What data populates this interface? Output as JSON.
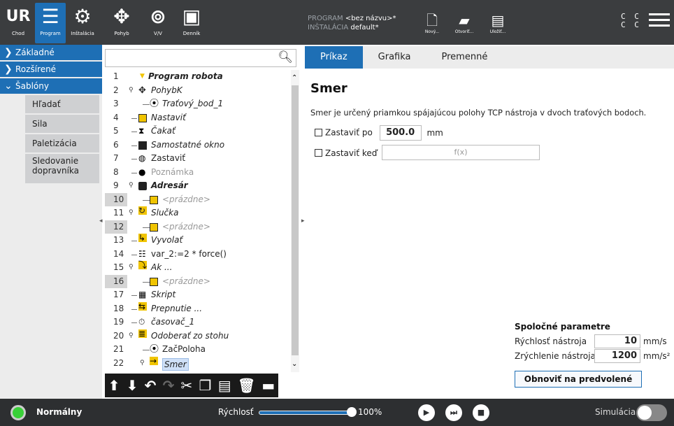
{
  "nav": {
    "chod": "Chod",
    "program": "Program",
    "instalacia": "Inštalácia",
    "pohyb": "Pohyb",
    "vv": "V/V",
    "dennik": "Denník"
  },
  "program_info": {
    "program_key": "PROGRAM",
    "program_val": "<bez názvu>*",
    "install_key": "INŠTALÁCIA",
    "install_val": "default*"
  },
  "file": {
    "new": "Nový...",
    "open": "Otvoriť...",
    "save": "Uložiť..."
  },
  "cc": {
    "line1": "C C",
    "line2": "C C"
  },
  "leftmenu": {
    "zakladne": "Základné",
    "rozsirene": "Rozšírené",
    "sablony": "Šablóny",
    "subs": [
      "Hľadať",
      "Sila",
      "Paletizácia",
      "Sledovanie dopravníka"
    ]
  },
  "tree": [
    {
      "n": "1",
      "t": "Program robota"
    },
    {
      "n": "2",
      "t": "PohybK"
    },
    {
      "n": "3",
      "t": "Traťový_bod_1"
    },
    {
      "n": "4",
      "t": "Nastaviť"
    },
    {
      "n": "5",
      "t": "Čakať"
    },
    {
      "n": "6",
      "t": "Samostatné okno"
    },
    {
      "n": "7",
      "t": "Zastaviť"
    },
    {
      "n": "8",
      "t": "Poznámka"
    },
    {
      "n": "9",
      "t": "Adresár"
    },
    {
      "n": "10",
      "t": "<prázdne>"
    },
    {
      "n": "11",
      "t": "Slučka"
    },
    {
      "n": "12",
      "t": "<prázdne>"
    },
    {
      "n": "13",
      "t": "Vyvolať"
    },
    {
      "n": "14",
      "t": "var_2:=2 * force()"
    },
    {
      "n": "15",
      "t": "Ak ..."
    },
    {
      "n": "16",
      "t": "<prázdne>"
    },
    {
      "n": "17",
      "t": "Skript"
    },
    {
      "n": "18",
      "t": "Prepnutie ..."
    },
    {
      "n": "19",
      "t": "časovač_1"
    },
    {
      "n": "20",
      "t": "Odoberať zo stohu"
    },
    {
      "n": "21",
      "t": "ZačPoloha"
    },
    {
      "n": "22",
      "t": "Smer"
    }
  ],
  "tabs": {
    "prikaz": "Príkaz",
    "grafika": "Grafika",
    "premenne": "Premenné"
  },
  "main": {
    "title": "Smer",
    "desc": "Smer je určený priamkou spájajúcou polohy TCP nástroja v dvoch traťových bodoch.",
    "stop_after_label": "Zastaviť po",
    "stop_after_value": "500.0",
    "stop_after_unit": "mm",
    "stop_when_label": "Zastaviť keď",
    "fx": "f(x)"
  },
  "params": {
    "heading": "Spoločné parametre",
    "speed_label": "Rýchlosť nástroja",
    "speed_value": "10",
    "speed_unit": "mm/s",
    "accel_label": "Zrýchlenie nástroja",
    "accel_value": "1200",
    "accel_unit": "mm/s²",
    "reset": "Obnoviť na predvolené"
  },
  "bottom": {
    "status": "Normálny",
    "speed_label": "Rýchlosť",
    "speed_value": "100%",
    "speed_fraction": 1.0,
    "sim": "Simulácia"
  },
  "colors": {
    "accent": "#1e6fb5",
    "topbar": "#3b3d3f",
    "status_ok": "#39d038"
  }
}
